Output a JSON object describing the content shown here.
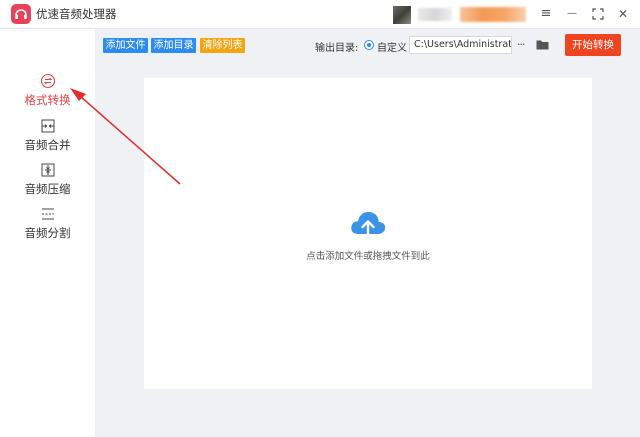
{
  "app": {
    "title": "优速音频处理器",
    "colors": {
      "brand": "#e9435b",
      "primary": "#2d8cf0",
      "warning": "#f3a514",
      "danger": "#f0431f",
      "active_text": "#e84343"
    }
  },
  "titlebar": {
    "icons": [
      "menu-icon",
      "minimize-icon",
      "fullscreen-icon",
      "close-icon"
    ],
    "menu_glyph": "≡",
    "minimize_glyph": "—",
    "fullscreen_glyph": "⛶",
    "close_glyph": "✕"
  },
  "sidebar": {
    "items": [
      {
        "label": "格式转换",
        "icon": "format-convert-icon",
        "active": true
      },
      {
        "label": "音频合并",
        "icon": "audio-merge-icon",
        "active": false
      },
      {
        "label": "音频压缩",
        "icon": "audio-compress-icon",
        "active": false
      },
      {
        "label": "音频分割",
        "icon": "audio-split-icon",
        "active": false
      }
    ]
  },
  "toolbar": {
    "add_file": "添加文件",
    "add_dir": "添加目录",
    "clear_list": "清除列表",
    "output_label": "输出目录:",
    "radio_label": "自定义",
    "output_path": "C:\\Users\\Administrator\\",
    "more": "···",
    "start_button": "开始转换"
  },
  "main": {
    "drop_hint": "点击添加文件或拖拽文件到此",
    "drop_icon": "cloud-upload-icon"
  }
}
